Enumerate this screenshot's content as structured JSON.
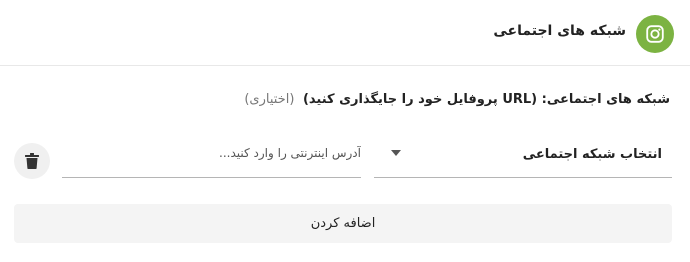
{
  "header": {
    "icon": "instagram-icon",
    "icon_color": "#7cb342",
    "title": "شبکه های اجتماعی"
  },
  "field": {
    "label": "شبکه های اجتماعی: (URL پروفایل خود را جایگذاری کنید)",
    "optional": "(اختیاری)"
  },
  "select": {
    "value": "انتخاب شبکه اجتماعی",
    "icon": "caret-down-icon"
  },
  "url_input": {
    "value": "",
    "placeholder": "آدرس اینترنتی را وارد کنید..."
  },
  "delete_button": {
    "icon": "trash-icon"
  },
  "add_button": {
    "label": "اضافه کردن"
  }
}
